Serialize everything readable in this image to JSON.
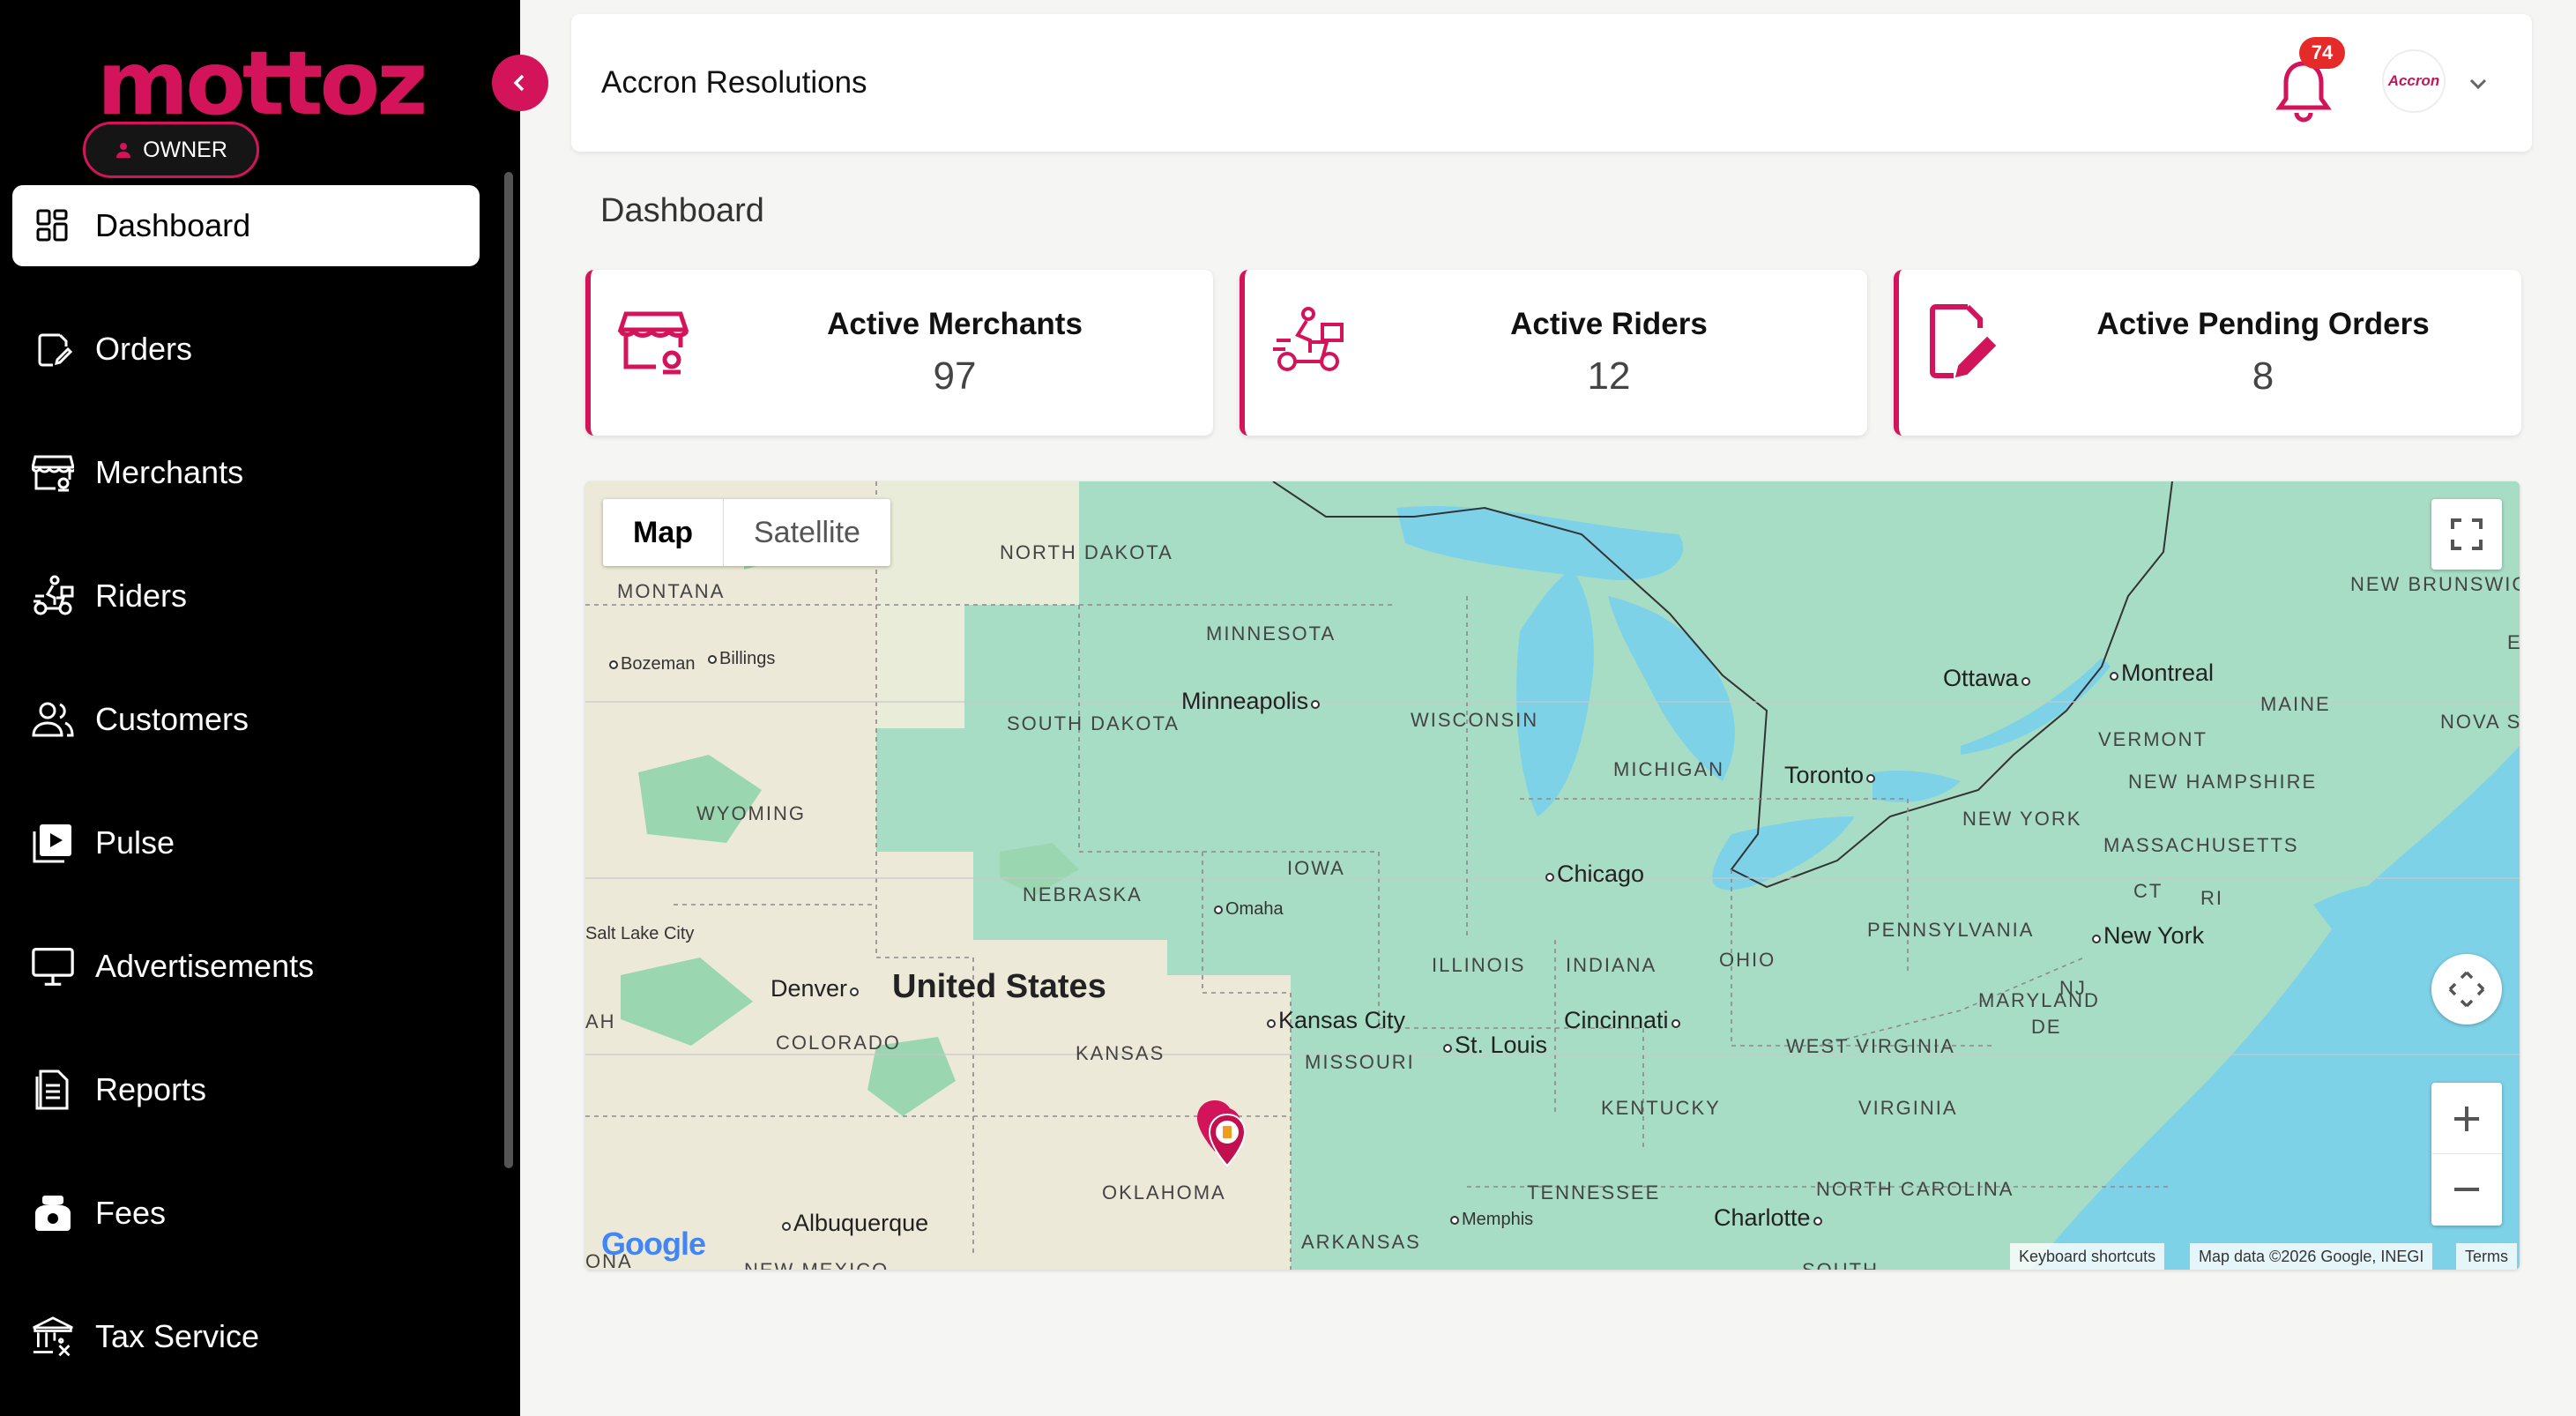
{
  "app": {
    "brand": "mottoz",
    "role": "OWNER",
    "accent_color": "#d4145a"
  },
  "sidebar": {
    "items": [
      {
        "label": "Dashboard",
        "icon": "dashboard-icon",
        "active": true
      },
      {
        "label": "Orders",
        "icon": "orders-icon"
      },
      {
        "label": "Merchants",
        "icon": "store-icon"
      },
      {
        "label": "Riders",
        "icon": "rider-icon"
      },
      {
        "label": "Customers",
        "icon": "users-icon"
      },
      {
        "label": "Pulse",
        "icon": "play-icon"
      },
      {
        "label": "Advertisements",
        "icon": "monitor-icon"
      },
      {
        "label": "Reports",
        "icon": "report-icon"
      },
      {
        "label": "Fees",
        "icon": "fees-icon"
      },
      {
        "label": "Tax Service",
        "icon": "tax-icon"
      }
    ]
  },
  "header": {
    "company": "Accron Resolutions",
    "notification_count": "74",
    "avatar_text": "Accron"
  },
  "page": {
    "title": "Dashboard"
  },
  "stats": [
    {
      "label": "Active Merchants",
      "value": "97",
      "icon": "store-icon"
    },
    {
      "label": "Active Riders",
      "value": "12",
      "icon": "rider-icon"
    },
    {
      "label": "Active Pending Orders",
      "value": "8",
      "icon": "edit-document-icon"
    }
  ],
  "map": {
    "type_map": "Map",
    "type_satellite": "Satellite",
    "country": "United States",
    "states": {
      "north_dakota": "NORTH DAKOTA",
      "montana": "MONTANA",
      "minnesota": "MINNESOTA",
      "south_dakota": "SOUTH DAKOTA",
      "wisconsin": "WISCONSIN",
      "michigan": "MICHIGAN",
      "wyoming": "WYOMING",
      "iowa": "IOWA",
      "nebraska": "NEBRASKA",
      "illinois": "ILLINOIS",
      "indiana": "INDIANA",
      "ohio": "OHIO",
      "pennsylvania": "PENNSYLVANIA",
      "colorado": "COLORADO",
      "kansas": "KANSAS",
      "missouri": "MISSOURI",
      "kentucky": "KENTUCKY",
      "west_virginia": "WEST VIRGINIA",
      "virginia": "VIRGINIA",
      "maryland": "MARYLAND",
      "new_york": "NEW YORK",
      "vermont": "VERMONT",
      "new_hampshire": "NEW HAMPSHIRE",
      "massachusetts": "MASSACHUSETTS",
      "maine": "MAINE",
      "new_brunswick": "NEW BRUNSWICK",
      "nova": "NOVA S",
      "ct": "CT",
      "ri": "RI",
      "nj": "NJ",
      "de": "DE",
      "oklahoma": "OKLAHOMA",
      "arkansas": "ARKANSAS",
      "tennessee": "TENNESSEE",
      "north_carolina": "NORTH CAROLINA",
      "ah": "AH",
      "ona": "ONA",
      "new_mexico": "NEW MEXICO",
      "south": "SOUTH",
      "e": "E"
    },
    "cities": {
      "bozeman": "Bozeman",
      "billings": "Billings",
      "minneapolis": "Minneapolis",
      "ottawa": "Ottawa",
      "montreal": "Montreal",
      "toronto": "Toronto",
      "chicago": "Chicago",
      "omaha": "Omaha",
      "salt_lake": "Salt Lake City",
      "denver": "Denver",
      "kansas_city": "Kansas City",
      "st_louis": "St. Louis",
      "cincinnati": "Cincinnati",
      "new_york_city": "New York",
      "memphis": "Memphis",
      "charlotte": "Charlotte",
      "albuquerque": "Albuquerque"
    },
    "attribution": {
      "shortcuts": "Keyboard shortcuts",
      "data": "Map data ©2026 Google, INEGI",
      "terms": "Terms"
    },
    "logo": "Google"
  }
}
